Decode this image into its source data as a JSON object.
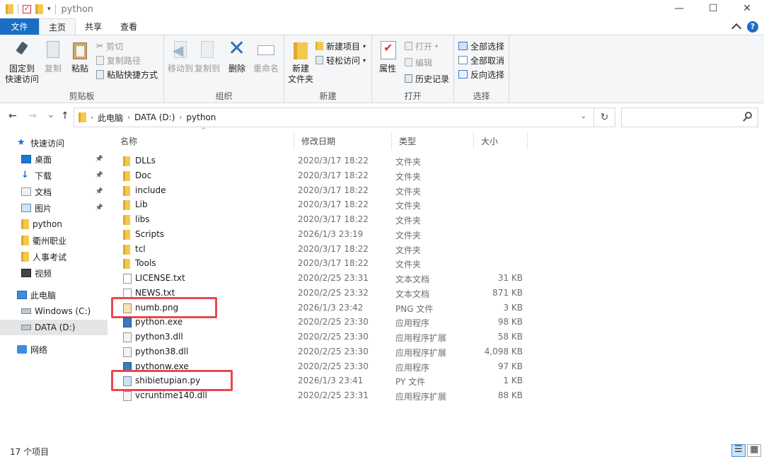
{
  "window": {
    "title": "python",
    "controls": {
      "minimize": "—",
      "maximize": "☐",
      "close": "✕"
    }
  },
  "ribbon_tabs": [
    "文件",
    "主页",
    "共享",
    "查看"
  ],
  "help_label": "?",
  "ribbon": {
    "clipboard": {
      "label": "剪贴板",
      "pin": "固定到\n快速访问",
      "copy": "复制",
      "paste": "粘贴",
      "cut": "剪切",
      "copy_path": "复制路径",
      "paste_shortcut": "粘贴快捷方式"
    },
    "organize": {
      "label": "组织",
      "move_to": "移动到",
      "copy_to": "复制到",
      "delete": "删除",
      "rename": "重命名"
    },
    "new": {
      "label": "新建",
      "new_folder": "新建\n文件夹",
      "new_item": "新建项目",
      "easy_access": "轻松访问"
    },
    "open": {
      "label": "打开",
      "properties": "属性",
      "open": "打开",
      "edit": "编辑",
      "history": "历史记录"
    },
    "select": {
      "label": "选择",
      "select_all": "全部选择",
      "select_none": "全部取消",
      "invert": "反向选择"
    }
  },
  "nav": {
    "back": "←",
    "forward": "→",
    "recent": "⌄",
    "up": "↑",
    "breadcrumb": [
      "此电脑",
      "DATA (D:)",
      "python"
    ],
    "search_placeholder": ""
  },
  "sidebar": [
    {
      "label": "快速访问",
      "icon": "star-icon"
    },
    {
      "label": "桌面",
      "icon": "desktop-icon",
      "pinned": true
    },
    {
      "label": "下载",
      "icon": "download-icon",
      "pinned": true
    },
    {
      "label": "文档",
      "icon": "documents-icon",
      "pinned": true
    },
    {
      "label": "图片",
      "icon": "pictures-icon",
      "pinned": true
    },
    {
      "label": "python",
      "icon": "folder-icon"
    },
    {
      "label": "衢州职业",
      "icon": "folder-icon"
    },
    {
      "label": "人事考试",
      "icon": "folder-icon"
    },
    {
      "label": "视频",
      "icon": "video-icon"
    },
    {
      "label": "此电脑",
      "icon": "computer-icon"
    },
    {
      "label": "Windows (C:)",
      "icon": "drive-icon"
    },
    {
      "label": "DATA (D:)",
      "icon": "drive-icon",
      "selected": true
    },
    {
      "label": "网络",
      "icon": "network-icon"
    }
  ],
  "columns": {
    "name": "名称",
    "date": "修改日期",
    "type": "类型",
    "size": "大小"
  },
  "files": [
    {
      "name": "DLLs",
      "date": "2020/3/17 18:22",
      "type": "文件夹",
      "size": "",
      "icon": "folder"
    },
    {
      "name": "Doc",
      "date": "2020/3/17 18:22",
      "type": "文件夹",
      "size": "",
      "icon": "folder"
    },
    {
      "name": "include",
      "date": "2020/3/17 18:22",
      "type": "文件夹",
      "size": "",
      "icon": "folder"
    },
    {
      "name": "Lib",
      "date": "2020/3/17 18:22",
      "type": "文件夹",
      "size": "",
      "icon": "folder"
    },
    {
      "name": "libs",
      "date": "2020/3/17 18:22",
      "type": "文件夹",
      "size": "",
      "icon": "folder"
    },
    {
      "name": "Scripts",
      "date": "2026/1/3 23:19",
      "type": "文件夹",
      "size": "",
      "icon": "folder"
    },
    {
      "name": "tcl",
      "date": "2020/3/17 18:22",
      "type": "文件夹",
      "size": "",
      "icon": "folder"
    },
    {
      "name": "Tools",
      "date": "2020/3/17 18:22",
      "type": "文件夹",
      "size": "",
      "icon": "folder"
    },
    {
      "name": "LICENSE.txt",
      "date": "2020/2/25 23:31",
      "type": "文本文档",
      "size": "31 KB",
      "icon": "txt"
    },
    {
      "name": "NEWS.txt",
      "date": "2020/2/25 23:32",
      "type": "文本文档",
      "size": "871 KB",
      "icon": "txt"
    },
    {
      "name": "numb.png",
      "date": "2026/1/3 23:42",
      "type": "PNG 文件",
      "size": "3 KB",
      "icon": "png",
      "highlighted": true
    },
    {
      "name": "python.exe",
      "date": "2020/2/25 23:30",
      "type": "应用程序",
      "size": "98 KB",
      "icon": "exe"
    },
    {
      "name": "python3.dll",
      "date": "2020/2/25 23:30",
      "type": "应用程序扩展",
      "size": "58 KB",
      "icon": "dll"
    },
    {
      "name": "python38.dll",
      "date": "2020/2/25 23:30",
      "type": "应用程序扩展",
      "size": "4,098 KB",
      "icon": "dll"
    },
    {
      "name": "pythonw.exe",
      "date": "2020/2/25 23:30",
      "type": "应用程序",
      "size": "97 KB",
      "icon": "exe"
    },
    {
      "name": "shibietupian.py",
      "date": "2026/1/3 23:41",
      "type": "PY 文件",
      "size": "1 KB",
      "icon": "py",
      "highlighted": true
    },
    {
      "name": "vcruntime140.dll",
      "date": "2020/2/25 23:31",
      "type": "应用程序扩展",
      "size": "88 KB",
      "icon": "dll"
    }
  ],
  "status": {
    "item_count": "17 个项目"
  },
  "colors": {
    "accent": "#1a6ec6",
    "highlight_box": "#e8484f",
    "folder": "#f2c94c"
  }
}
